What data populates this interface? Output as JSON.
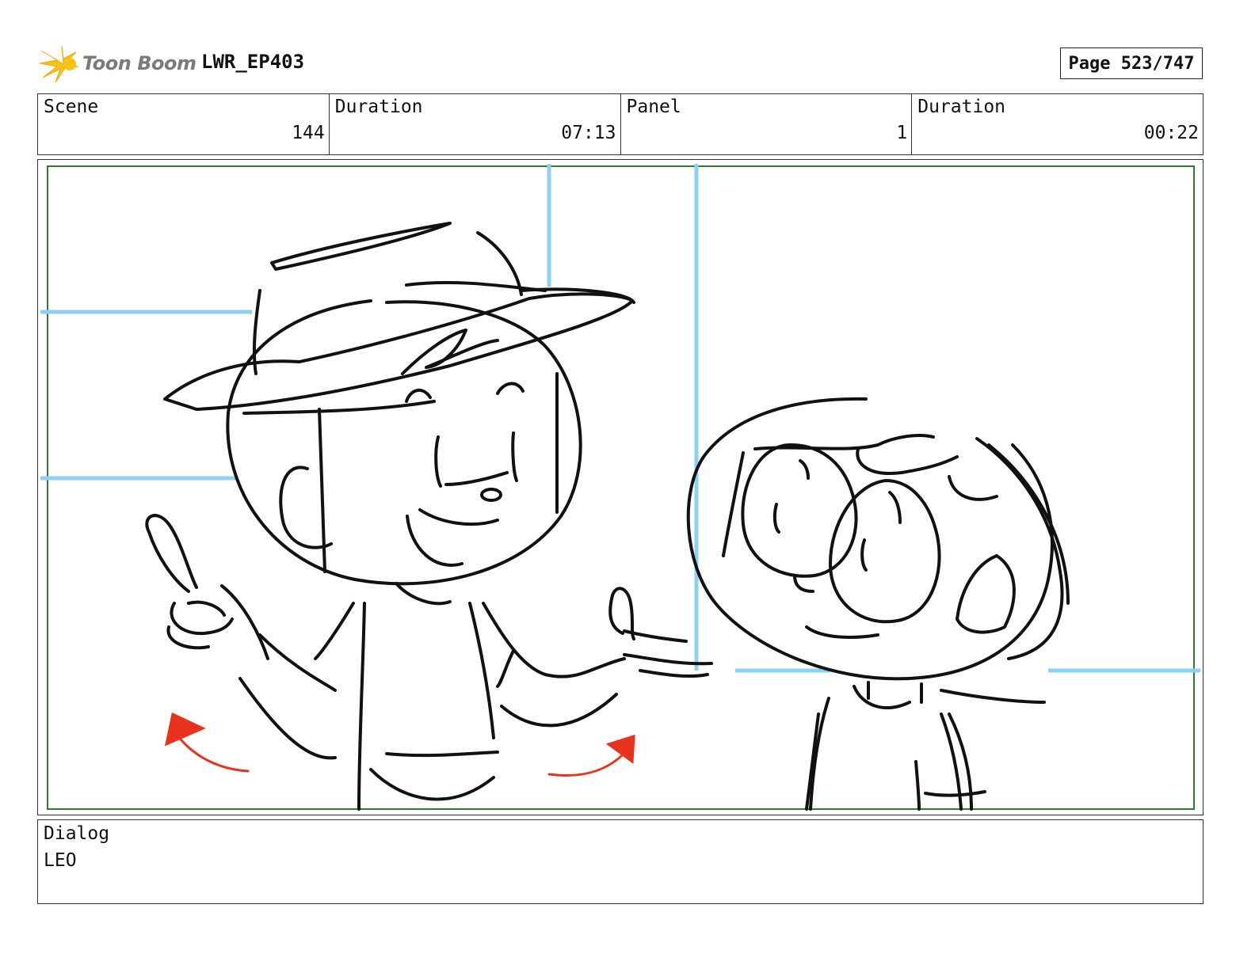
{
  "header": {
    "logo_text": "Toon Boom",
    "project_title": "LWR_EP403",
    "page_counter": "Page 523/747"
  },
  "info": {
    "scene_label": "Scene",
    "scene_value": "144",
    "scene_duration_label": "Duration",
    "scene_duration_value": "07:13",
    "panel_label": "Panel",
    "panel_value": "1",
    "panel_duration_label": "Duration",
    "panel_duration_value": "00:22"
  },
  "dialog": {
    "label": "Dialog",
    "text": "LEO"
  },
  "colors": {
    "frame_green": "#2e7d32",
    "guide_blue": "#8fd0f2",
    "arrow_red": "#e8321e",
    "logo_yellow": "#f6c21a"
  }
}
